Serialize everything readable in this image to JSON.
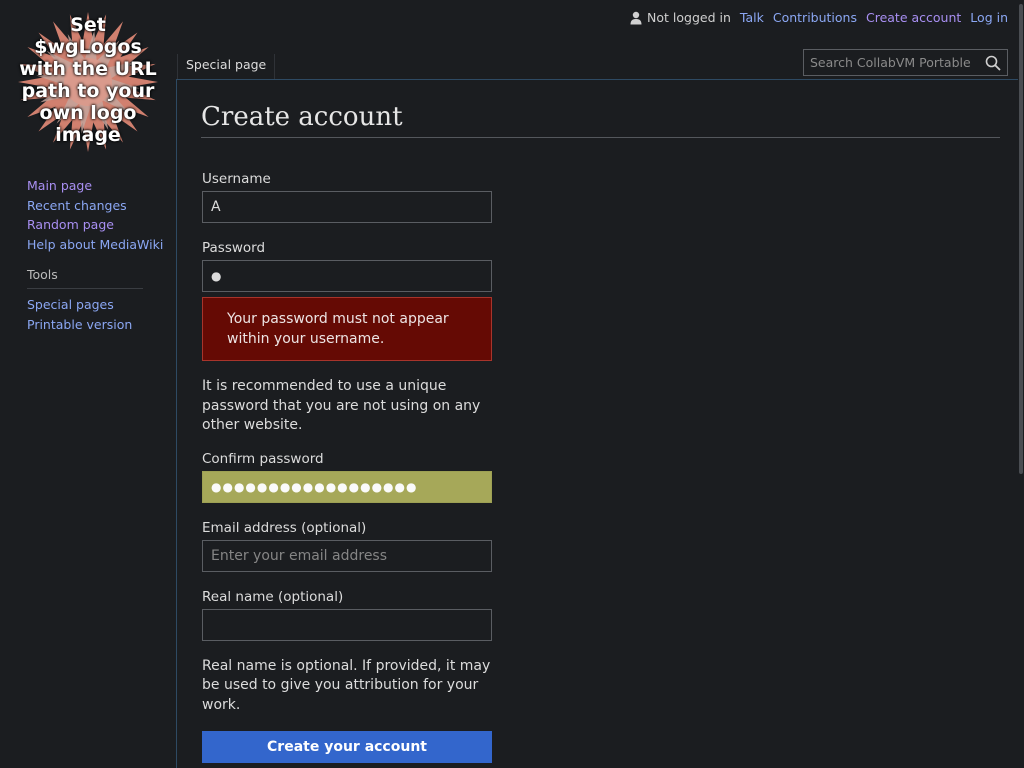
{
  "logo": {
    "text": "Set\n$wgLogos\nwith the URL\npath to your\nown logo\nimage"
  },
  "sidebar": {
    "navigation": [
      {
        "label": "Main page"
      },
      {
        "label": "Recent changes"
      },
      {
        "label": "Random page"
      },
      {
        "label": "Help about MediaWiki"
      }
    ],
    "tools_heading": "Tools",
    "tools": [
      {
        "label": "Special pages"
      },
      {
        "label": "Printable version"
      }
    ]
  },
  "personal": {
    "status": "Not logged in",
    "talk": "Talk",
    "contributions": "Contributions",
    "create_account": "Create account",
    "login": "Log in"
  },
  "tabs": {
    "special_page": "Special page"
  },
  "search": {
    "placeholder": "Search CollabVM Portable"
  },
  "main": {
    "title": "Create account",
    "form": {
      "username_label": "Username",
      "username_value": "A",
      "password_label": "Password",
      "password_mask": "●",
      "error_message": "Your password must not appear within your username.",
      "password_hint": "It is recommended to use a unique password that you are not using on any other website.",
      "confirm_label": "Confirm password",
      "confirm_mask": "●●●●●●●●●●●●●●●●●●",
      "email_label": "Email address (optional)",
      "email_placeholder": "Enter your email address",
      "realname_label": "Real name (optional)",
      "realname_value": "",
      "realname_hint": "Real name is optional. If provided, it may be used to give you attribution for your work.",
      "submit_label": "Create your account"
    }
  },
  "colors": {
    "background": "#1b1d20",
    "link": "#8ba7f3",
    "visited_link": "#a88ff2",
    "error_bg": "#650a04",
    "confirm_bg": "#a6a859",
    "primary_button": "#3366cc"
  }
}
